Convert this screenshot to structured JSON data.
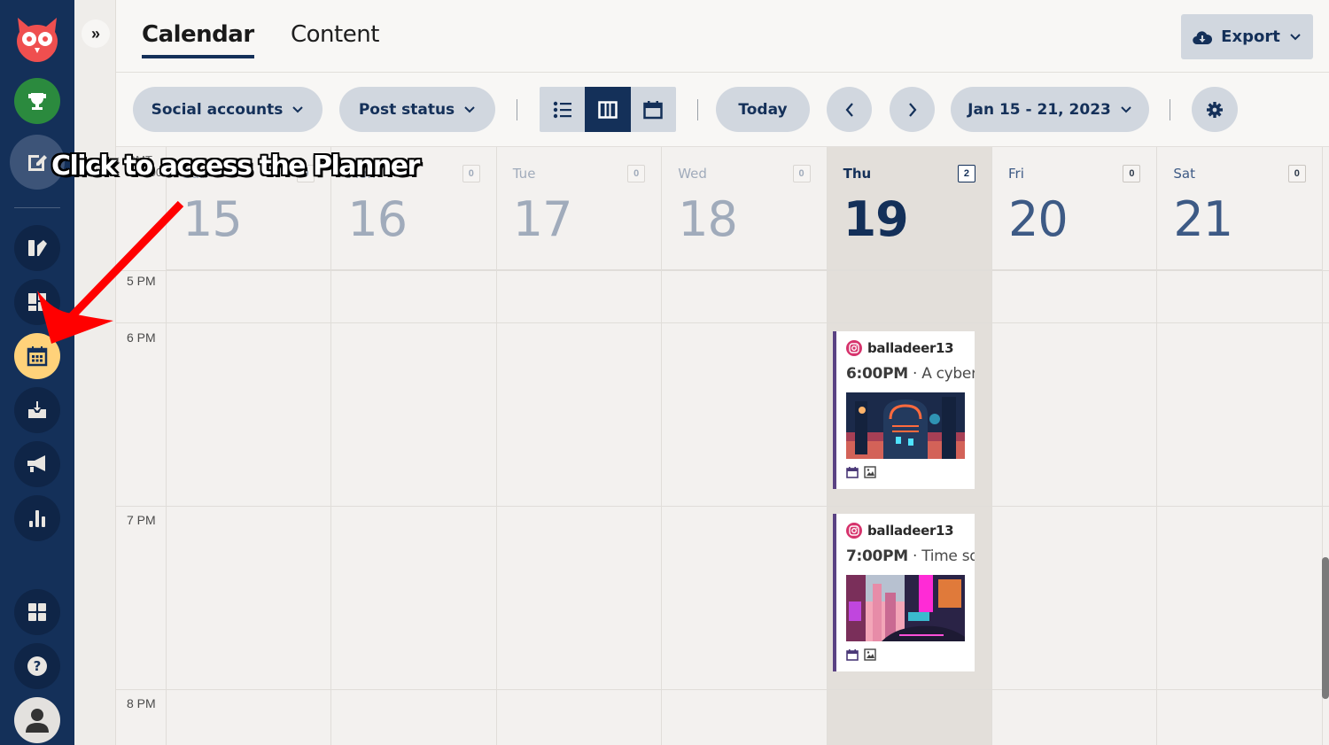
{
  "nav": {
    "items": [
      {
        "id": "logo",
        "icon": "owl-logo-icon"
      },
      {
        "id": "trophy",
        "icon": "trophy-icon",
        "color": "#2b8a3e"
      },
      {
        "id": "compose",
        "icon": "compose-icon"
      },
      {
        "id": "streams",
        "icon": "streams-icon"
      },
      {
        "id": "dashboard",
        "icon": "dashboard-icon"
      },
      {
        "id": "planner",
        "icon": "calendar-icon",
        "active": true,
        "color": "#ffd27a"
      },
      {
        "id": "inbox",
        "icon": "inbox-icon"
      },
      {
        "id": "advertise",
        "icon": "megaphone-icon"
      },
      {
        "id": "analytics",
        "icon": "bar-chart-icon"
      },
      {
        "id": "apps",
        "icon": "apps-grid-icon"
      },
      {
        "id": "help",
        "icon": "help-icon"
      },
      {
        "id": "profile",
        "icon": "avatar-icon"
      }
    ]
  },
  "subpanel": {
    "expand_icon": "»"
  },
  "header": {
    "tabs": [
      {
        "label": "Calendar",
        "active": true
      },
      {
        "label": "Content",
        "active": false
      }
    ],
    "export_label": "Export"
  },
  "toolbar": {
    "social_accounts_label": "Social accounts",
    "post_status_label": "Post status",
    "views": [
      "list",
      "week",
      "month"
    ],
    "active_view": "week",
    "today_label": "Today",
    "date_range_label": "Jan 15 - 21, 2023"
  },
  "calendar": {
    "timezone_line1": "GMT",
    "timezone_line2": "+08:00",
    "days": [
      {
        "name": "Sun",
        "num": "15",
        "count": "0",
        "state": "past"
      },
      {
        "name": "Mon",
        "num": "16",
        "count": "0",
        "state": "past"
      },
      {
        "name": "Tue",
        "num": "17",
        "count": "0",
        "state": "past"
      },
      {
        "name": "Wed",
        "num": "18",
        "count": "0",
        "state": "past"
      },
      {
        "name": "Thu",
        "num": "19",
        "count": "2",
        "state": "today"
      },
      {
        "name": "Fri",
        "num": "20",
        "count": "0",
        "state": "future"
      },
      {
        "name": "Sat",
        "num": "21",
        "count": "0",
        "state": "future"
      }
    ],
    "hours": [
      "5 PM",
      "6 PM",
      "7 PM",
      "8 PM"
    ],
    "posts": [
      {
        "account": "balladeer13",
        "time": "6:00PM",
        "separator": " · ",
        "text": "A cyberpunk",
        "network": "instagram"
      },
      {
        "account": "balladeer13",
        "time": "7:00PM",
        "separator": " · ",
        "text": "Time square",
        "network": "instagram"
      }
    ]
  },
  "overlay": {
    "callout": "Click to access the Planner",
    "arrow_color": "#ff0000"
  }
}
